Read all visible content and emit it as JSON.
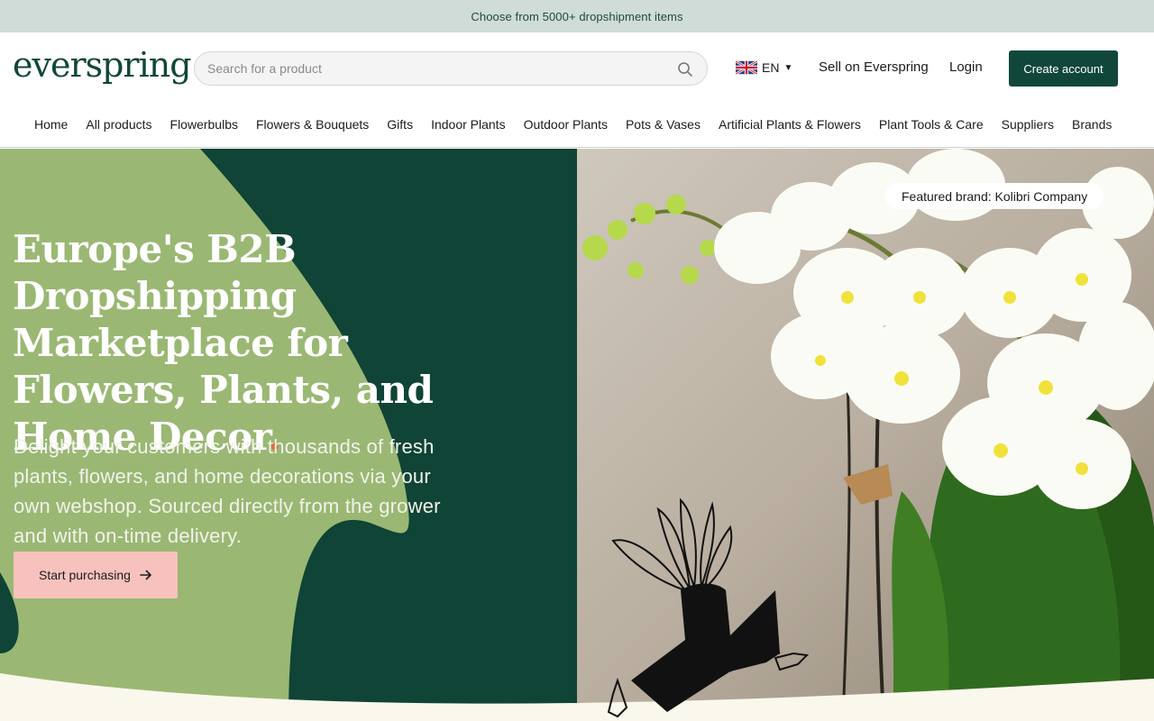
{
  "announcement": "Choose from 5000+ dropshipment items",
  "header": {
    "logo": "everspring",
    "search_placeholder": "Search for a product",
    "language": "EN",
    "sell_link": "Sell on Everspring",
    "login_link": "Login",
    "create_account": "Create account"
  },
  "nav": {
    "items": [
      {
        "label": "Home"
      },
      {
        "label": "All products"
      },
      {
        "label": "Flowerbulbs"
      },
      {
        "label": "Flowers & Bouquets"
      },
      {
        "label": "Gifts"
      },
      {
        "label": "Indoor Plants"
      },
      {
        "label": "Outdoor Plants"
      },
      {
        "label": "Pots & Vases"
      },
      {
        "label": "Artificial Plants & Flowers"
      },
      {
        "label": "Plant Tools & Care"
      },
      {
        "label": "Suppliers"
      },
      {
        "label": "Brands"
      }
    ]
  },
  "hero": {
    "headline": "Europe's B2B Dropshipping Marketplace for Flowers, Plants, and Home Decor",
    "headline_dot": ".",
    "subtext": "Delight your customers with thousands of fresh plants, flowers, and home decorations via your own webshop. Sourced directly from the grower and with on-time delivery.",
    "cta": "Start purchasing",
    "featured_badge": "Featured brand: Kolibri Company"
  },
  "colors": {
    "brand_dark_green": "#10473a",
    "leaf_green": "#9ab873",
    "cta_pink": "#f7c2bd",
    "accent_orange": "#e8693a",
    "announcement_bg": "#cfdcd8",
    "cream": "#faf8ec"
  },
  "icons": {
    "search": "search-icon",
    "arrow": "arrow-right-icon",
    "flag": "uk-flag-icon",
    "caret": "caret-down-icon"
  }
}
